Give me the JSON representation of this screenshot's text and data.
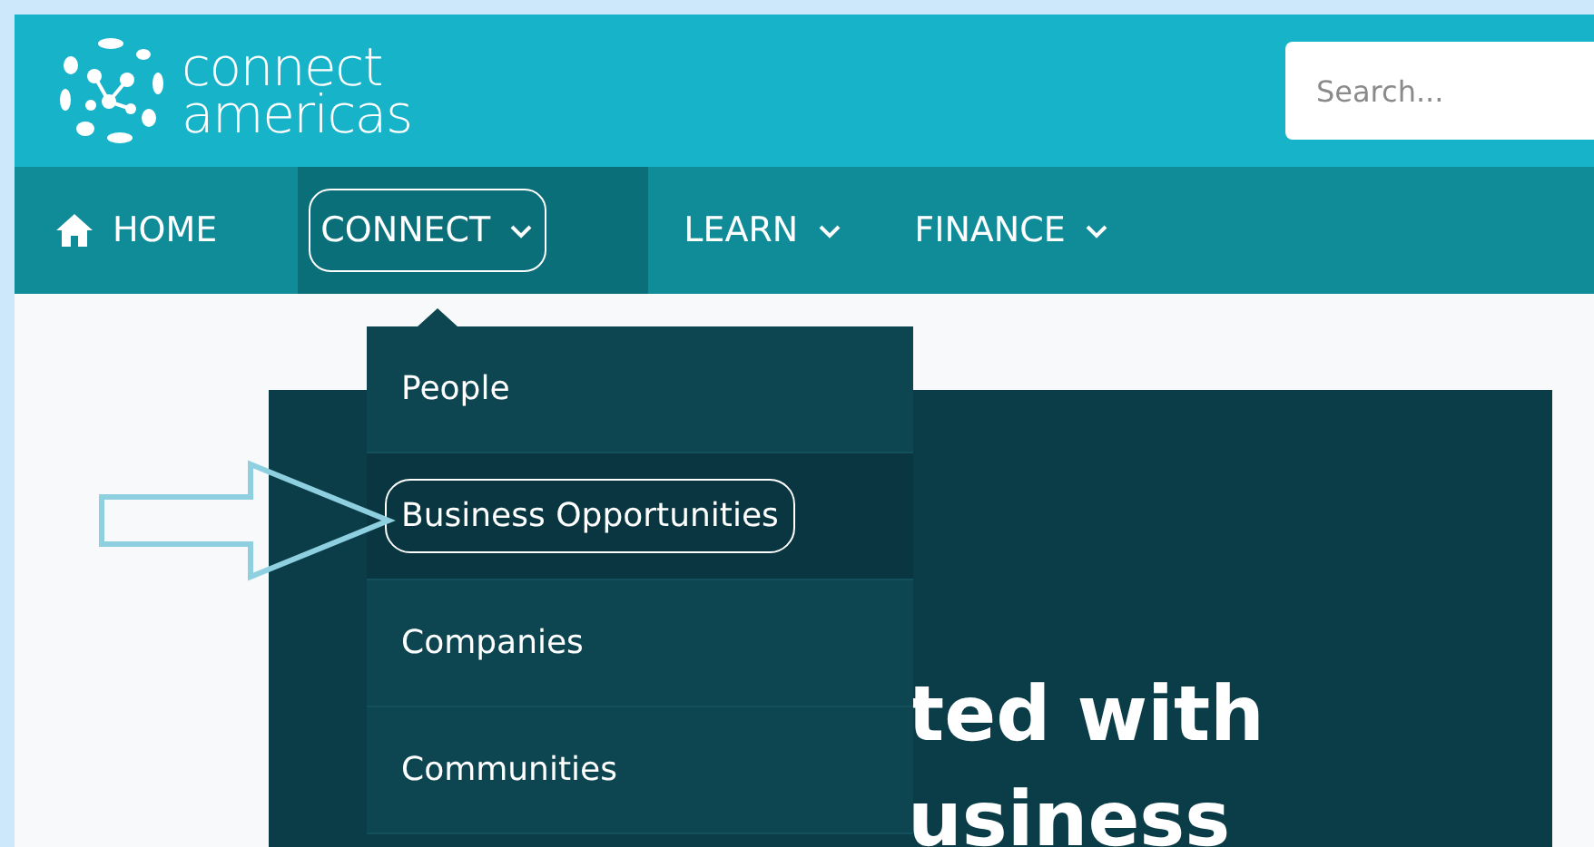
{
  "header": {
    "logo": {
      "line_1": "connect",
      "line_2": "americas"
    },
    "search": {
      "placeholder": "Search..."
    }
  },
  "nav": {
    "items": [
      {
        "label": "HOME",
        "kind": "home",
        "selected": false
      },
      {
        "label": "CONNECT",
        "kind": "dropdown",
        "selected": true
      },
      {
        "label": "LEARN",
        "kind": "dropdown",
        "selected": false
      },
      {
        "label": "FINANCE",
        "kind": "dropdown",
        "selected": false
      }
    ]
  },
  "dropdown": {
    "items": [
      {
        "label": "People",
        "selected": false
      },
      {
        "label": "Business Opportunities",
        "selected": true
      },
      {
        "label": "Companies",
        "selected": false
      },
      {
        "label": "Communities",
        "selected": false
      }
    ]
  },
  "hero": {
    "lines": [
      "ted with",
      "usiness"
    ]
  }
}
